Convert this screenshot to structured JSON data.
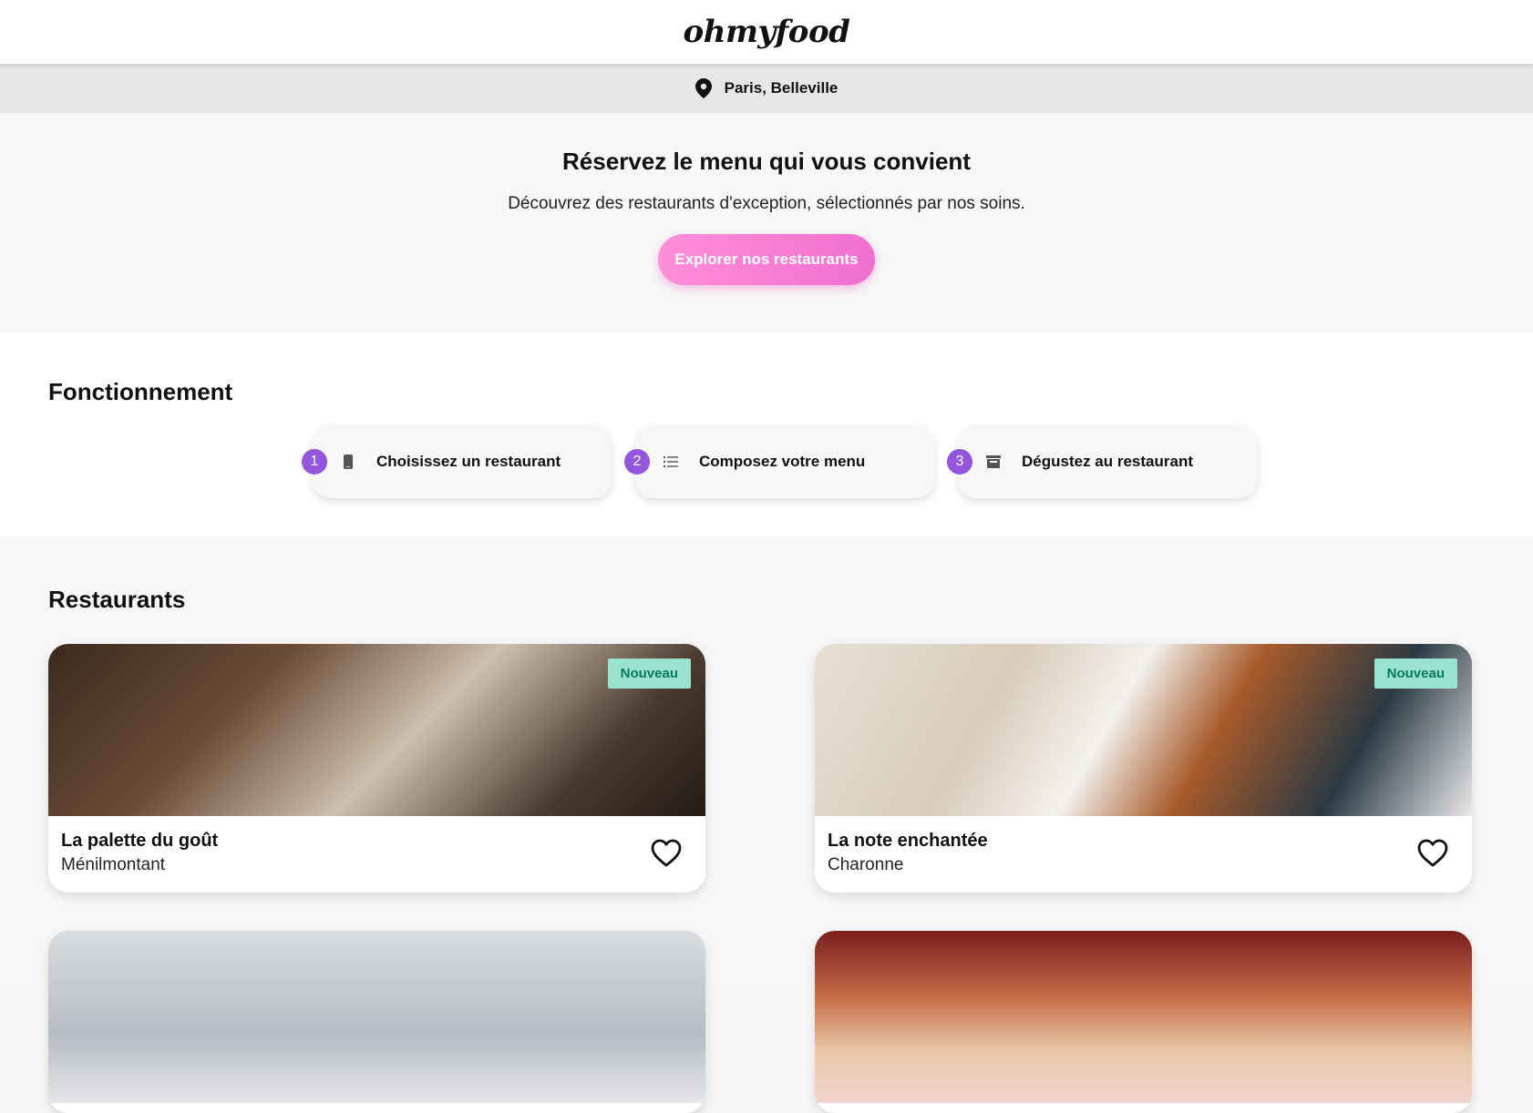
{
  "header": {
    "logo": "ohmyfood"
  },
  "location": {
    "icon": "location-pin-icon",
    "text": "Paris, Belleville"
  },
  "hero": {
    "title": "Réservez le menu qui vous convient",
    "subtitle": "Découvrez des restaurants d'exception, sélectionnés par nos soins.",
    "cta_label": "Explorer nos restaurants"
  },
  "how": {
    "title": "Fonctionnement",
    "steps": [
      {
        "num": "1",
        "icon": "phone-icon",
        "label": "Choisissez un restaurant"
      },
      {
        "num": "2",
        "icon": "list-icon",
        "label": "Composez votre menu"
      },
      {
        "num": "3",
        "icon": "store-icon",
        "label": "Dégustez au restaurant"
      }
    ]
  },
  "restaurants": {
    "title": "Restaurants",
    "items": [
      {
        "name": "La palette du goût",
        "area": "Ménilmontant",
        "badge": "Nouveau"
      },
      {
        "name": "La note enchantée",
        "area": "Charonne",
        "badge": "Nouveau"
      }
    ]
  },
  "colors": {
    "accent_purple": "#9356dc",
    "cta_pink": "#ef6fd0",
    "badge_bg": "#99e2d0",
    "badge_text": "#0b7a5c"
  }
}
